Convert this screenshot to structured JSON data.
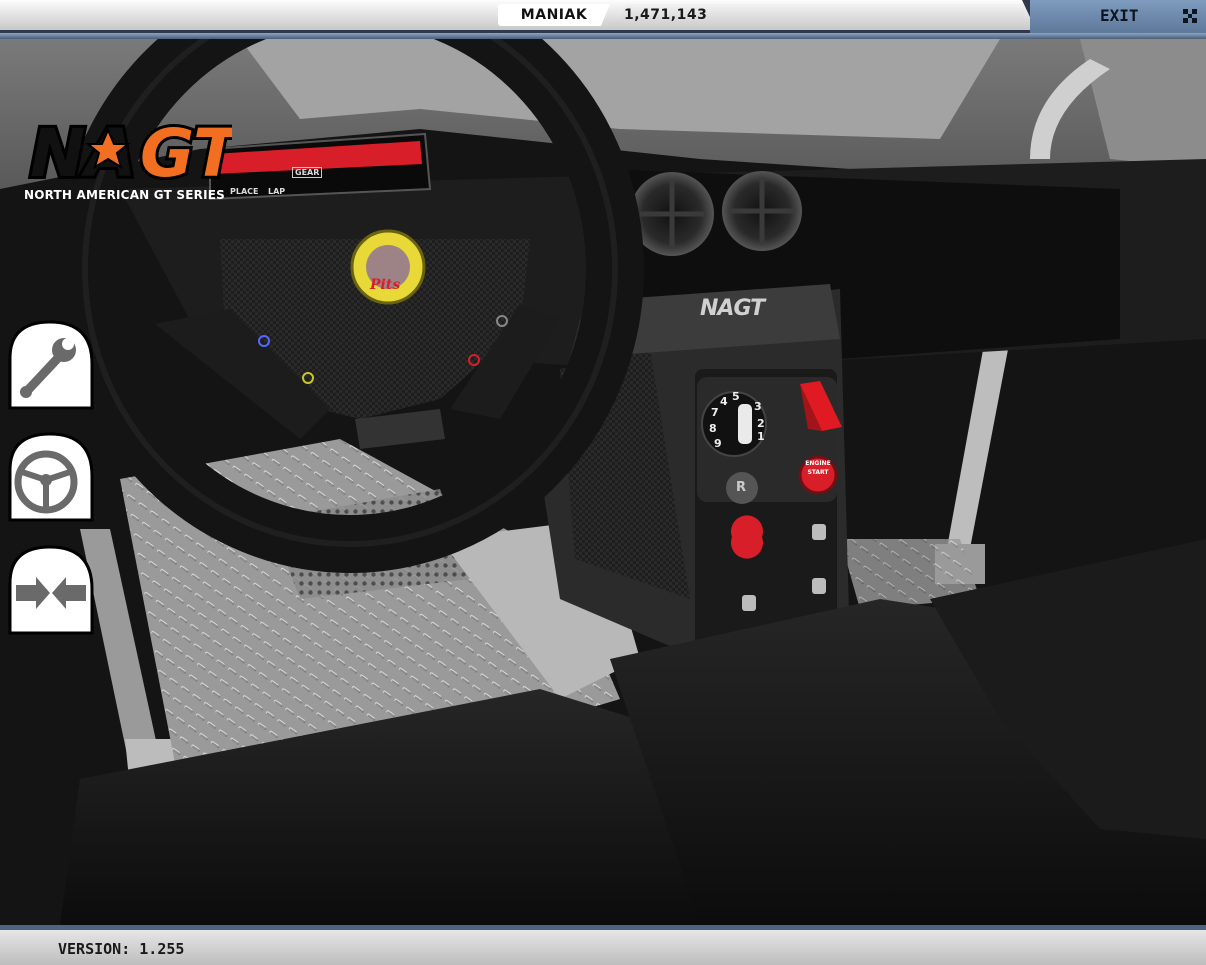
{
  "topbar": {
    "username": "MANIAK",
    "score": "1,471,143",
    "exit_label": "EXIT"
  },
  "logo": {
    "brand": "NAGT",
    "tagline": "NORTH AMERICAN GT SERIES"
  },
  "dashboard": {
    "steering_hub_text": "Pits",
    "console_badge": "NAGT",
    "screen_labels": [
      "PLACE",
      "LAP",
      "GEAR"
    ],
    "ignition_numbers": [
      "5",
      "4",
      "3",
      "7",
      "2",
      "8",
      "1",
      "9"
    ],
    "reverse_label": "R",
    "engine_start_label": [
      "ENGINE",
      "START"
    ]
  },
  "sidebar": {
    "tabs": [
      {
        "name": "wrench-tab",
        "icon": "wrench-icon"
      },
      {
        "name": "steering-tab",
        "icon": "steering-wheel-icon"
      },
      {
        "name": "compress-tab",
        "icon": "compress-arrows-icon"
      }
    ]
  },
  "footer": {
    "version_label": "VERSION: 1.255"
  },
  "colors": {
    "accent_red": "#d81e28",
    "logo_orange": "#f26f21",
    "top_blue": "#6f89ab"
  }
}
